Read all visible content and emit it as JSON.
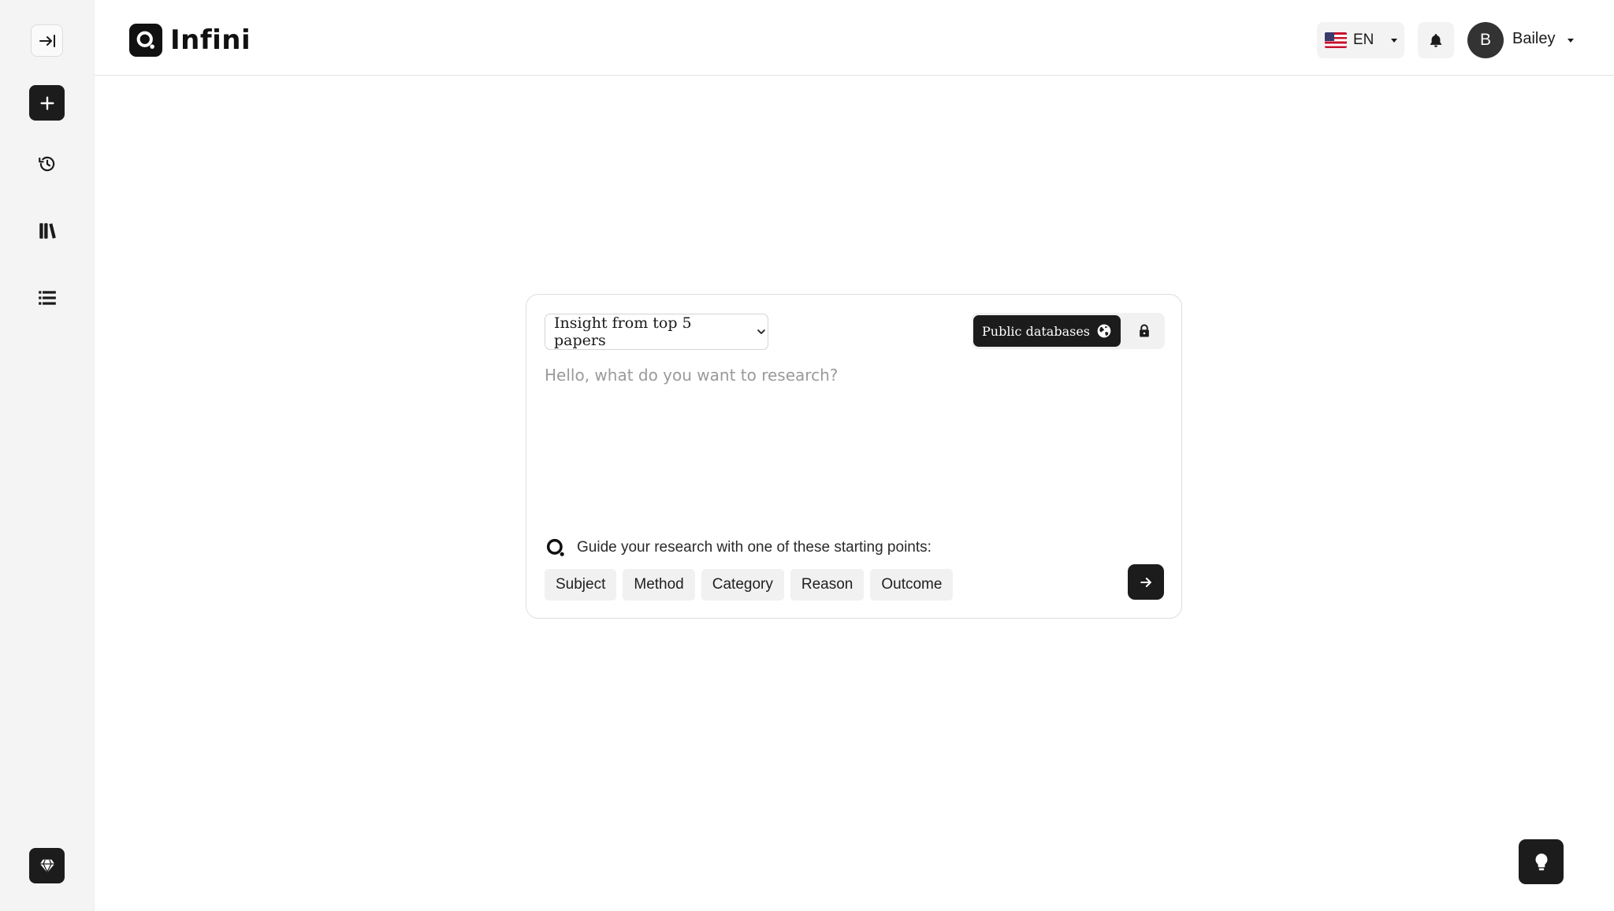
{
  "app": {
    "name": "Infini"
  },
  "header": {
    "language": {
      "code": "EN",
      "flag": "us-flag-icon"
    },
    "user": {
      "initial": "B",
      "name": "Bailey"
    }
  },
  "sidebar": {
    "items": [
      {
        "name": "collapse-sidebar",
        "icon": "arrow-right-bar-icon"
      },
      {
        "name": "new-research",
        "icon": "plus-icon"
      },
      {
        "name": "history",
        "icon": "history-icon"
      },
      {
        "name": "library",
        "icon": "books-icon"
      },
      {
        "name": "lists",
        "icon": "list-icon"
      },
      {
        "name": "premium",
        "icon": "diamond-icon"
      }
    ]
  },
  "research": {
    "mode": {
      "selected": "Insight from top 5 papers"
    },
    "databases": {
      "public_label": "Public databases",
      "selected": "public"
    },
    "prompt": {
      "value": "",
      "placeholder": "Hello, what do you want to research?"
    },
    "guide_text": "Guide your research with one of these starting points:",
    "chips": [
      "Subject",
      "Method",
      "Category",
      "Reason",
      "Outcome"
    ]
  },
  "colors": {
    "accent": "#1c1c1c",
    "background": "#ffffff",
    "sidebar": "#f4f4f4",
    "chip": "#f1f1f1"
  }
}
